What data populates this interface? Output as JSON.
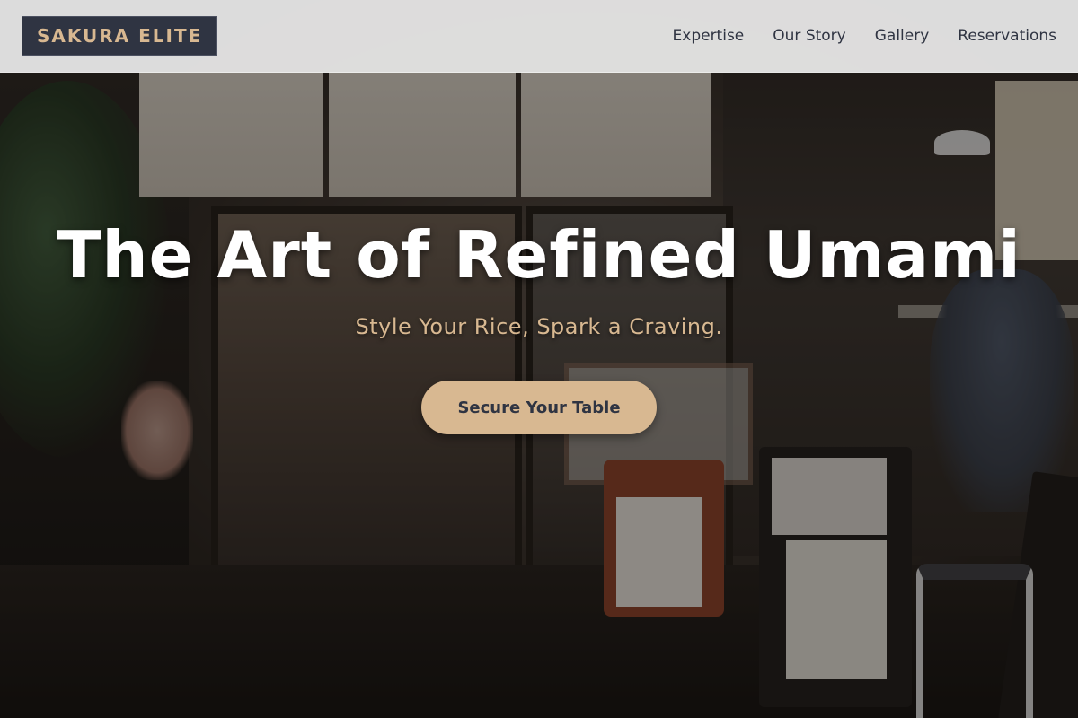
{
  "brand": {
    "name": "SAKURA ELITE"
  },
  "nav": {
    "items": [
      {
        "label": "Expertise"
      },
      {
        "label": "Our Story"
      },
      {
        "label": "Gallery"
      },
      {
        "label": "Reservations"
      }
    ]
  },
  "hero": {
    "title": "The Art of Refined Umami",
    "subtitle": "Style Your Rice, Spark a Craving.",
    "cta_label": "Secure Your Table"
  },
  "colors": {
    "accent": "#d8b891",
    "brand_dark": "#2f3442",
    "header_bg": "#ececec"
  }
}
